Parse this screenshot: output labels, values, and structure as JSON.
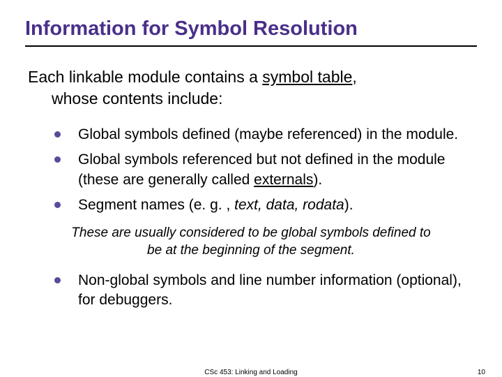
{
  "title": "Information for Symbol Resolution",
  "intro": {
    "line1_pre": "Each linkable module contains a ",
    "line1_ul": "symbol table",
    "line1_post": ",",
    "line2": "whose contents include:"
  },
  "bullets": [
    {
      "text": "Global symbols defined (maybe referenced) in the module."
    },
    {
      "pre": "Global symbols referenced but not defined in the module (these are generally called ",
      "ul": "externals",
      "post": ")."
    },
    {
      "pre": "Segment names (e. g. , ",
      "it": "text, data, rodata",
      "post": ")."
    }
  ],
  "note": "These are usually considered to be global symbols defined to be at the beginning of the segment.",
  "bullets2": [
    {
      "text": "Non-global symbols and line number information (optional), for debuggers."
    }
  ],
  "footer": {
    "center": "CSc 453: Linking and Loading",
    "page": "10"
  },
  "colors": {
    "title": "#4a2f8a",
    "bullet": "#5a4a9a"
  }
}
